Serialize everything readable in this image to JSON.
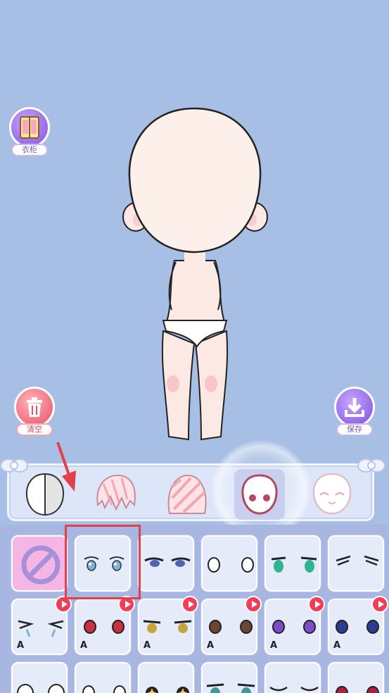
{
  "side_buttons": {
    "wardrobe": {
      "label": "衣柜",
      "icon": "wardrobe-icon"
    },
    "clear": {
      "label": "清空",
      "icon": "trash-icon"
    },
    "save": {
      "label": "保存",
      "icon": "download-icon"
    }
  },
  "categories": [
    {
      "name": "base-face",
      "icon": "face-base-icon",
      "selected": false
    },
    {
      "name": "front-hair",
      "icon": "front-hair-icon",
      "selected": false
    },
    {
      "name": "back-hair",
      "icon": "back-hair-icon",
      "selected": false
    },
    {
      "name": "eyes",
      "icon": "eyes-category-icon",
      "selected": true
    },
    {
      "name": "expression",
      "icon": "expression-icon",
      "selected": false
    }
  ],
  "eye_options": {
    "row1": [
      "none",
      "blue-round",
      "blue-narrow",
      "blank-outline",
      "green",
      "closed-lines"
    ],
    "row2_letter": "A",
    "row2": [
      "teary-closed",
      "red",
      "yellow-gold",
      "brown",
      "purple",
      "navy"
    ],
    "row3": [
      "white-large",
      "white-small",
      "yellow-star",
      "teal",
      "sleepy-closed",
      "crimson"
    ]
  },
  "colors": {
    "background": "#a7bfe4",
    "accent_pink": "#f5b6e6",
    "play_badge": "#ee3e5a",
    "highlight_box": "#e2414a"
  }
}
